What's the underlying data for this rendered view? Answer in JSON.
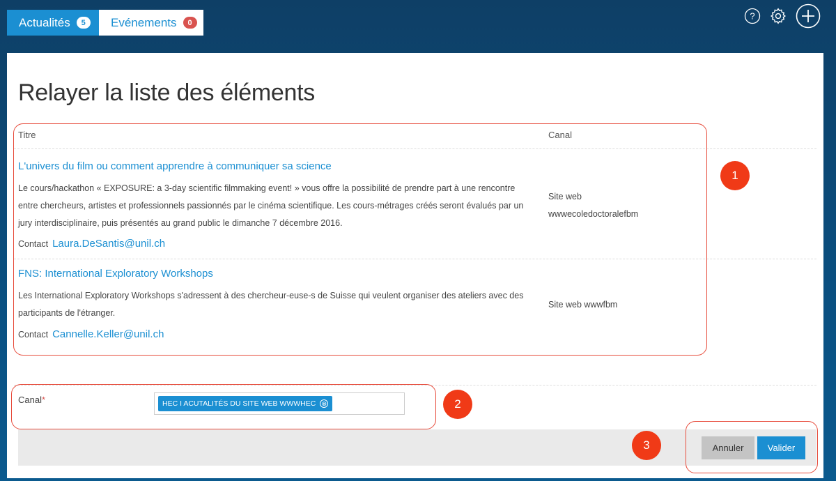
{
  "tabs": [
    {
      "label": "Actualités",
      "count": "5"
    },
    {
      "label": "Evénements",
      "count": "0"
    }
  ],
  "top_icons": [
    "help-icon",
    "gear-icon",
    "plus-icon"
  ],
  "page": {
    "title": "Relayer la liste des éléments"
  },
  "table": {
    "headers": {
      "title": "Titre",
      "canal": "Canal"
    },
    "rows": [
      {
        "title": "L'univers du film ou comment apprendre à communiquer sa science",
        "description": "Le cours/hackathon « EXPOSURE: a 3-day scientific filmmaking event! » vous offre la possibilité de prendre part à une rencontre entre chercheurs, artistes et professionnels passionnés par le cinéma scientifique. Les cours-métrages créés seront évalués par un jury interdisciplinaire, puis présentés au grand public le dimanche 7 décembre 2016.",
        "contact_label": "Contact",
        "contact_email": "Laura.DeSantis@unil.ch",
        "canal_line1": "Site web",
        "canal_line2": "wwwecoledoctoralefbm"
      },
      {
        "title": "FNS: International Exploratory Workshops",
        "description": "Les International Exploratory Workshops s'adressent à des chercheur-euse-s de Suisse qui veulent organiser des ateliers avec des participants de l'étranger.",
        "contact_label": "Contact",
        "contact_email": "Cannelle.Keller@unil.ch",
        "canal_line1": "Site web wwwfbm"
      }
    ]
  },
  "form": {
    "canal_label": "Canal",
    "required_mark": "*",
    "selected_tag": "HEC I ACUTALITÉS DU SITE WEB WWWHEC",
    "tag_remove": "⊗"
  },
  "buttons": {
    "cancel": "Annuler",
    "submit": "Valider"
  },
  "annotations": [
    "1",
    "2",
    "3"
  ],
  "colors": {
    "accent": "#1b8fd2",
    "badge_red": "#d9534f",
    "annotation": "#f03a17"
  }
}
